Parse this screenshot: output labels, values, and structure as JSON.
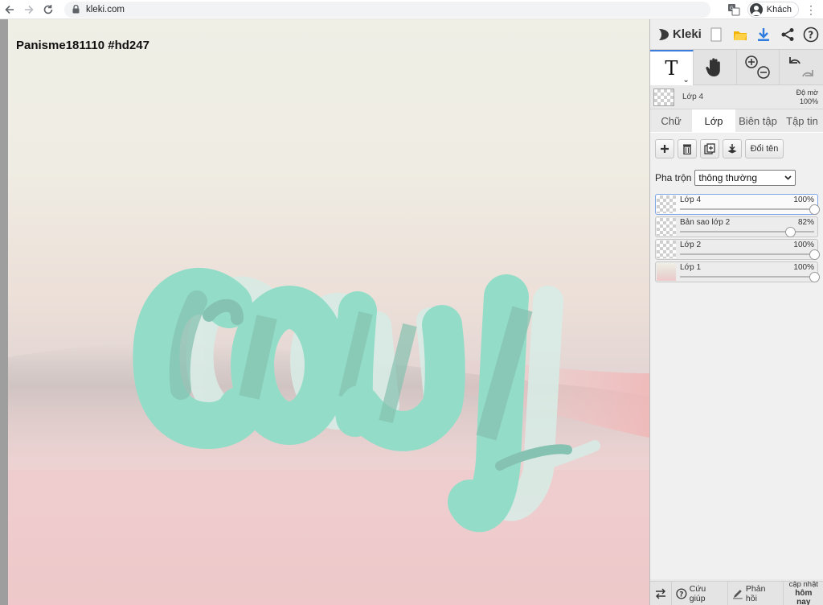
{
  "browser": {
    "url": "kleki.com",
    "profile_label": "Khách",
    "icons": [
      "back-arrow-icon",
      "forward-arrow-icon",
      "reload-icon",
      "lock-icon",
      "translate-icon",
      "avatar-icon",
      "kebab-menu-icon"
    ]
  },
  "canvas": {
    "title": "Panisme181110 #hd247",
    "artwork_text": "cauy",
    "colors": {
      "mint": "#93ddc8",
      "mint_shadow": "#86c2b1",
      "ghost": "#d9ece6",
      "sky": "#efefe6",
      "sand": "#eec8ca"
    }
  },
  "panel": {
    "logo": "Kleki",
    "tools": [
      "text-tool",
      "hand-tool",
      "zoom-tool",
      "undo-redo"
    ],
    "current_layer": {
      "name": "Lớp 4",
      "opacity_label": "Độ mờ",
      "opacity_value": "100%"
    },
    "tabs": [
      {
        "label": "Chữ"
      },
      {
        "label": "Lớp"
      },
      {
        "label": "Biên tập"
      },
      {
        "label": "Tập tin"
      }
    ],
    "layer_buttons": {
      "rename_label": "Đổi tên"
    },
    "blend": {
      "label": "Pha trộn",
      "value": "thông thường"
    },
    "layers": [
      {
        "name": "Lớp 4",
        "opacity": "100%",
        "level": 1.0
      },
      {
        "name": "Bản sao lớp 2",
        "opacity": "82%",
        "level": 0.82
      },
      {
        "name": "Lớp 2",
        "opacity": "100%",
        "level": 1.0
      },
      {
        "name": "Lớp 1",
        "opacity": "100%",
        "level": 1.0
      }
    ],
    "footer": {
      "help": "Cứu giúp",
      "feedback": "Phản hồi",
      "update_line1": "cập nhật",
      "update_line2": "hôm nay"
    }
  }
}
